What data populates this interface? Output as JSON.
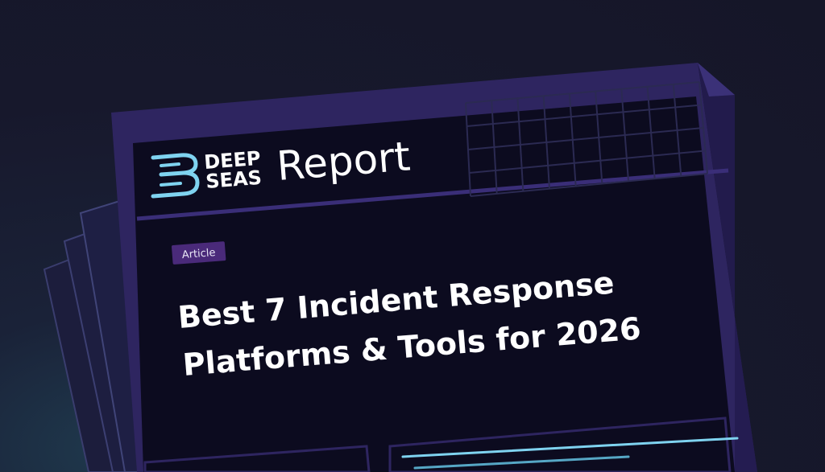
{
  "brand": {
    "line1": "DEEP",
    "line2": "SEAS",
    "logo_icon": "deepseas-logo-icon",
    "logo_color": "#7fd3f0"
  },
  "report_label": "Report",
  "badge": {
    "label": "Article",
    "color": "#4a2a7a"
  },
  "headline": {
    "line1": "Best 7 Incident Response",
    "line2": "Platforms & Tools for 2026"
  },
  "colors": {
    "background": "#17182c",
    "panel": "#0c0b1f",
    "frame": "#2e2560",
    "accent": "#7fd3f0"
  }
}
